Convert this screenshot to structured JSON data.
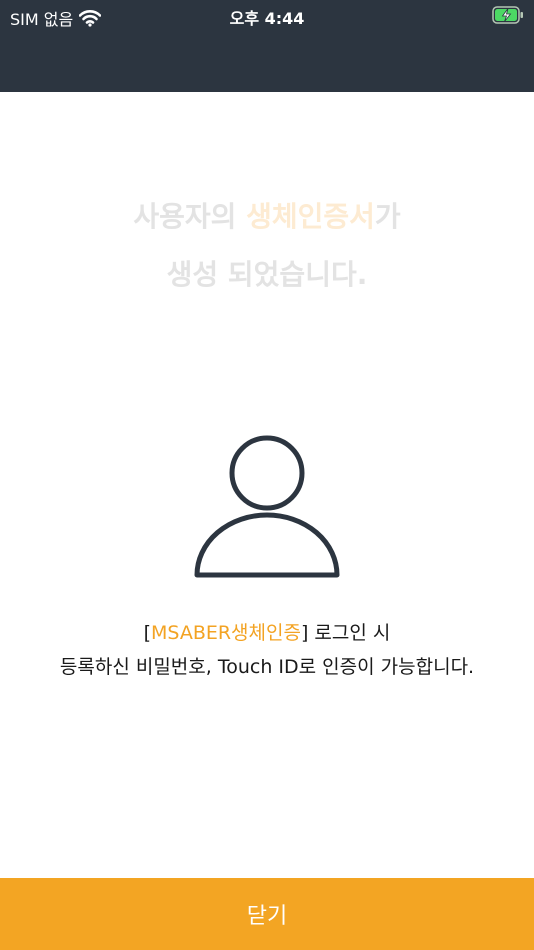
{
  "status_bar": {
    "carrier": "SIM 없음",
    "time": "오후 4:44"
  },
  "headline": {
    "line1_pre": "사용자의 ",
    "line1_accent": "생체인증서",
    "line1_post": "가",
    "line2": "생성 되었습니다."
  },
  "description": {
    "line1_open": "[",
    "line1_accent": "MSABER생체인증",
    "line1_post": "] 로그인 시",
    "line2": "등록하신 비밀번호, Touch ID로 인증이 가능합니다."
  },
  "close_button": {
    "label": "닫기"
  },
  "colors": {
    "header_bg": "#2c3540",
    "accent": "#f3a523",
    "headline_faded": "#e3e3e3",
    "headline_accent_faded": "#fdebd2"
  },
  "icons": {
    "wifi": "wifi-icon",
    "battery": "battery-charging-icon",
    "user": "user-icon"
  }
}
